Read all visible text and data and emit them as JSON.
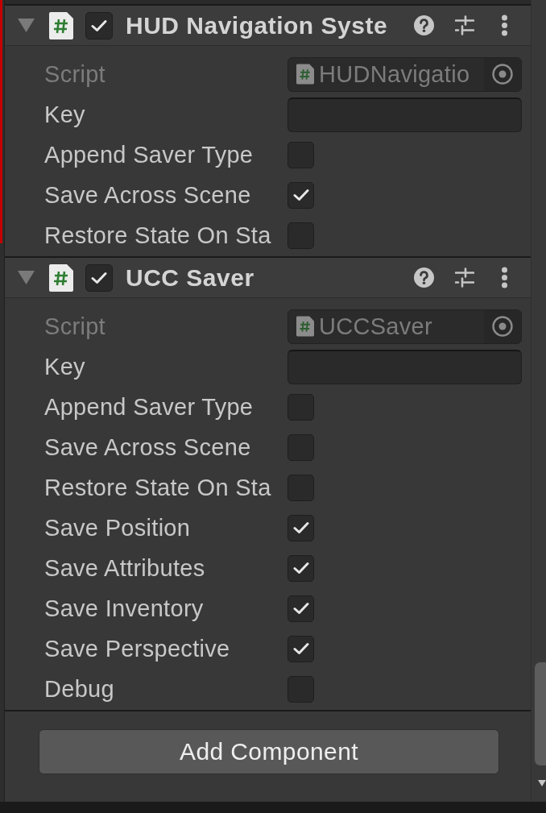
{
  "components": [
    {
      "title": "HUD Navigation Syste",
      "expanded": true,
      "enabled": true,
      "fields": [
        {
          "kind": "object",
          "label": "Script",
          "value": "HUDNavigatio",
          "disabled": true
        },
        {
          "kind": "text",
          "label": "Key",
          "disabled": false
        },
        {
          "kind": "toggle",
          "label": "Append Saver Type",
          "checked": false,
          "disabled": false
        },
        {
          "kind": "toggle",
          "label": "Save Across Scene",
          "checked": true,
          "disabled": false
        },
        {
          "kind": "toggle",
          "label": "Restore State On Sta",
          "checked": false,
          "disabled": false
        }
      ]
    },
    {
      "title": "UCC Saver",
      "expanded": true,
      "enabled": true,
      "fields": [
        {
          "kind": "object",
          "label": "Script",
          "value": "UCCSaver",
          "disabled": true
        },
        {
          "kind": "text",
          "label": "Key",
          "disabled": false
        },
        {
          "kind": "toggle",
          "label": "Append Saver Type",
          "checked": false,
          "disabled": false
        },
        {
          "kind": "toggle",
          "label": "Save Across Scene",
          "checked": false,
          "disabled": false
        },
        {
          "kind": "toggle",
          "label": "Restore State On Sta",
          "checked": false,
          "disabled": false
        },
        {
          "kind": "toggle",
          "label": "Save Position",
          "checked": true,
          "disabled": false
        },
        {
          "kind": "toggle",
          "label": "Save Attributes",
          "checked": true,
          "disabled": false
        },
        {
          "kind": "toggle",
          "label": "Save Inventory",
          "checked": true,
          "disabled": false
        },
        {
          "kind": "toggle",
          "label": "Save Perspective",
          "checked": true,
          "disabled": false
        },
        {
          "kind": "toggle",
          "label": "Debug",
          "checked": false,
          "disabled": false
        }
      ]
    }
  ],
  "add_component_button": {
    "label": "Add Component"
  }
}
